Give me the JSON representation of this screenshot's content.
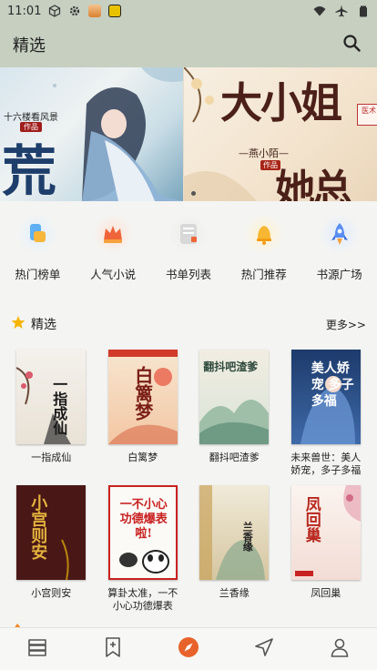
{
  "status_bar": {
    "time": "11:01"
  },
  "app_bar": {
    "title": "精选"
  },
  "banner": {
    "slides": [
      {
        "top_text": "十六楼看风景",
        "badge": "作品",
        "big_title": "荒"
      },
      {
        "title_line1": "大小姐",
        "title_line2": "她总",
        "author": "—燕小陌—",
        "author_tag": "作品",
        "side_label": "医术"
      }
    ]
  },
  "categories": [
    {
      "label": "热门榜单",
      "icon": "ranking-list-icon"
    },
    {
      "label": "人气小说",
      "icon": "popular-novel-icon"
    },
    {
      "label": "书单列表",
      "icon": "book-list-icon"
    },
    {
      "label": "热门推荐",
      "icon": "hot-recommend-icon"
    },
    {
      "label": "书源广场",
      "icon": "book-source-plaza-icon"
    }
  ],
  "section": {
    "title": "精选",
    "more": "更多>>",
    "icon": "star-icon"
  },
  "books_row1": [
    {
      "title": "一指成仙",
      "cover_text": "一指成仙"
    },
    {
      "title": "白篱梦",
      "cover_text": "白篱梦"
    },
    {
      "title": "翻抖吧渣爹",
      "cover_text": "翻抖吧渣爹"
    },
    {
      "title": "未来兽世：美人娇宠，多子多福",
      "cover_text": "美人娇宠 多子多福"
    }
  ],
  "books_row2": [
    {
      "title": "小宫则安",
      "cover_text": "小宫则安"
    },
    {
      "title": "算卦太准，一不小心功德爆表了！",
      "cover_text": "一不小心 功德爆表啦!"
    },
    {
      "title": "兰香缘",
      "cover_text": "兰香缘"
    },
    {
      "title": "凤回巢",
      "cover_text": "凤回巢"
    }
  ],
  "colors": {
    "header_bg": "#c6cfc0",
    "accent": "#e8632b",
    "page_bg": "#f4f4f2"
  },
  "bottom_nav": [
    {
      "name": "bookshelf-tab",
      "icon": "stack-icon"
    },
    {
      "name": "bookmark-tab",
      "icon": "bookmark-add-icon"
    },
    {
      "name": "discover-tab",
      "icon": "compass-icon",
      "active": true
    },
    {
      "name": "explore-tab",
      "icon": "navigation-arrow-icon"
    },
    {
      "name": "profile-tab",
      "icon": "user-icon"
    }
  ]
}
